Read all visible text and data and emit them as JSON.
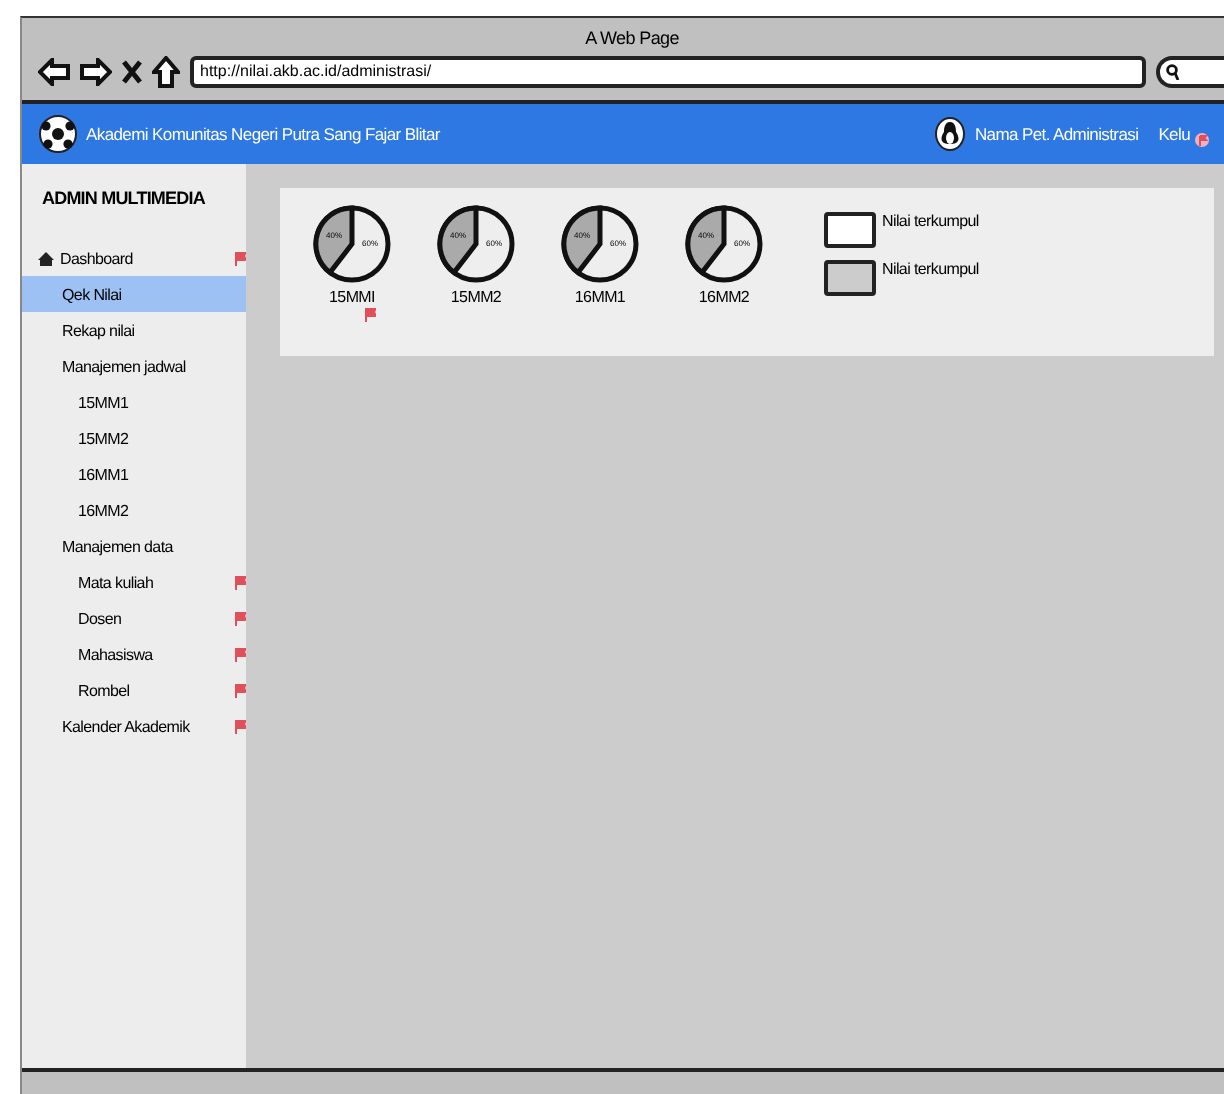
{
  "window": {
    "title": "A Web Page",
    "url": "http://nilai.akb.ac.id/administrasi/"
  },
  "header": {
    "site_name": "Akademi Komunitas Negeri Putra Sang Fajar Blitar",
    "user": "Nama Pet. Administrasi",
    "logout": "Kelu"
  },
  "sidebar": {
    "title": "ADMIN MULTIMEDIA",
    "items": [
      {
        "label": "Dashboard",
        "selected": false,
        "flag": true,
        "icon": true
      },
      {
        "label": "Qek Nilai",
        "selected": true,
        "flag": false
      },
      {
        "label": "Rekap nilai",
        "selected": false,
        "flag": false
      },
      {
        "label": "Manajemen jadwal",
        "selected": false,
        "flag": false,
        "children": [
          {
            "label": "15MM1",
            "selected": false,
            "flag": false
          },
          {
            "label": "15MM2",
            "selected": false,
            "flag": false
          },
          {
            "label": "16MM1",
            "selected": false,
            "flag": false
          },
          {
            "label": "16MM2",
            "selected": false,
            "flag": false
          }
        ]
      },
      {
        "label": "Manajemen data",
        "selected": false,
        "flag": false,
        "children": [
          {
            "label": "Mata kuliah",
            "selected": false,
            "flag": true
          },
          {
            "label": "Dosen",
            "selected": false,
            "flag": true
          },
          {
            "label": "Mahasiswa",
            "selected": false,
            "flag": true
          },
          {
            "label": "Rombel",
            "selected": false,
            "flag": true
          }
        ]
      },
      {
        "label": "Kalender Akademik",
        "selected": false,
        "flag": true
      }
    ]
  },
  "pies": [
    {
      "name": "15MMI",
      "labels": [
        "40%",
        "60%"
      ],
      "flag": true
    },
    {
      "name": "15MM2",
      "labels": [
        "40%",
        "60%"
      ],
      "flag": false
    },
    {
      "name": "16MM1",
      "labels": [
        "40%",
        "60%"
      ],
      "flag": false
    },
    {
      "name": "16MM2",
      "labels": [
        "40%",
        "60%"
      ],
      "flag": false
    }
  ],
  "legend": [
    {
      "label": "Nilai terkumpul",
      "color": "#ffffff"
    },
    {
      "label": "Nilai terkumpul",
      "color": "#cccccc"
    }
  ]
}
